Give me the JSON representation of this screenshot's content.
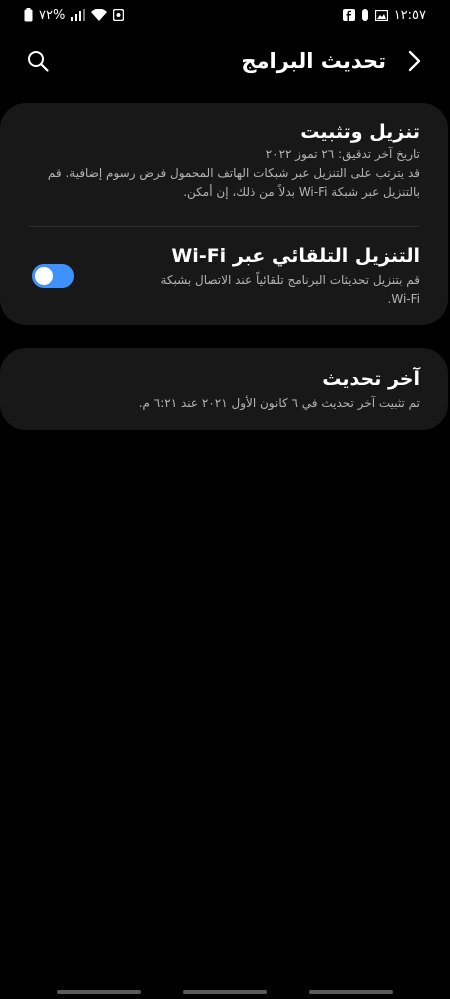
{
  "status_bar": {
    "time": "١٢:٥٧",
    "battery_percent": "٧٢%",
    "icons": [
      "battery-icon",
      "signal-icon",
      "wifi-icon",
      "nfc-icon",
      "image-icon",
      "facebook-icon",
      "alarm-icon"
    ]
  },
  "header": {
    "title": "تحديث البرامج",
    "back_icon": "chevron-right-icon",
    "search_icon": "search-icon"
  },
  "card_download": {
    "title": "تنزيل وتثبيت",
    "last_check": "تاريخ آخر تدقيق: ٢٦ تموز ٢٠٢٢",
    "desc_line1": "قد يترتب على التنزيل عبر شبكات الهاتف المحمول فرض رسوم إضافية. قم",
    "desc_line2": "بالتنزيل عبر شبكة Wi-Fi بدلاً من ذلك، إن أمكن.",
    "auto_title": "التنزيل التلقائي عبر Wi-Fi",
    "auto_desc_line1": "قم بتنزيل تحديثات البرنامج تلقائياً عند الاتصال بشبكة",
    "auto_desc_line2": "Wi-Fi.",
    "toggle_state": "off",
    "accent_color": "#3e91ff"
  },
  "card_last_update": {
    "title": "آخر تحديث",
    "desc": "تم تثبيت آخر تحديث في ٦ كانون الأول ٢٠٢١ عند ٦:٢١ م."
  }
}
